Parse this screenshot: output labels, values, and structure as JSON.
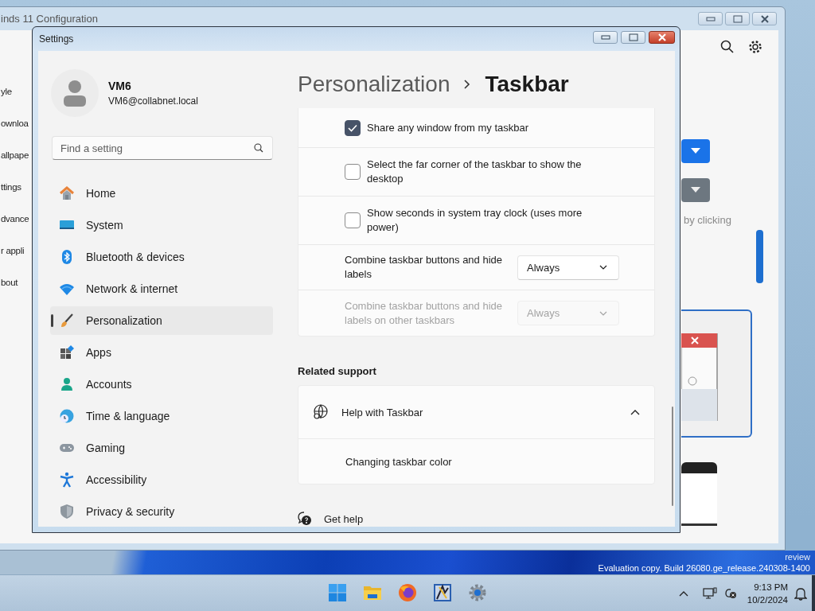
{
  "back_window": {
    "title": "inds 11 Configuration",
    "sidebar_items": [
      "yle",
      "ownloa",
      "allpape",
      "ttings",
      "dvance",
      "r appli",
      "bout"
    ],
    "hint": "by clicking"
  },
  "settings_window": {
    "title": "Settings",
    "user": {
      "name": "VM6",
      "email": "VM6@collabnet.local"
    },
    "search": {
      "placeholder": "Find a setting"
    },
    "nav": [
      {
        "label": "Home",
        "selected": false
      },
      {
        "label": "System",
        "selected": false
      },
      {
        "label": "Bluetooth & devices",
        "selected": false
      },
      {
        "label": "Network & internet",
        "selected": false
      },
      {
        "label": "Personalization",
        "selected": true
      },
      {
        "label": "Apps",
        "selected": false
      },
      {
        "label": "Accounts",
        "selected": false
      },
      {
        "label": "Time & language",
        "selected": false
      },
      {
        "label": "Gaming",
        "selected": false
      },
      {
        "label": "Accessibility",
        "selected": false
      },
      {
        "label": "Privacy & security",
        "selected": false
      }
    ],
    "breadcrumb": {
      "parent": "Personalization",
      "current": "Taskbar"
    },
    "settings": [
      {
        "kind": "checkbox",
        "label": "Share any window from my taskbar",
        "checked": true
      },
      {
        "kind": "checkbox",
        "label": "Select the far corner of the taskbar to show the desktop",
        "checked": false
      },
      {
        "kind": "checkbox",
        "label": "Show seconds in system tray clock (uses more power)",
        "checked": false
      },
      {
        "kind": "dropdown",
        "label": "Combine taskbar buttons and hide labels",
        "value": "Always",
        "disabled": false
      },
      {
        "kind": "dropdown",
        "label": "Combine taskbar buttons and hide labels on other taskbars",
        "value": "Always",
        "disabled": true
      }
    ],
    "related_support": {
      "heading": "Related support",
      "title": "Help with Taskbar",
      "expanded": true,
      "links": [
        "Changing taskbar color"
      ]
    },
    "get_help": "Get help"
  },
  "desktop": {
    "watermark": [
      "review",
      "Evaluation copy. Build 26080.ge_release.240308-1400"
    ]
  },
  "taskbar": {
    "time": "9:13 PM",
    "date": "10/2/2024"
  }
}
